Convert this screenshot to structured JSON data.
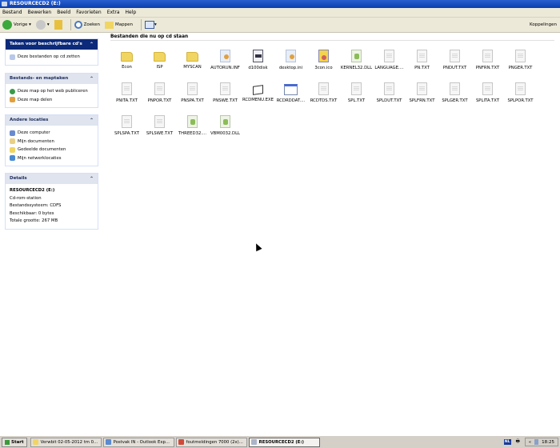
{
  "window": {
    "title": "RESOURCECD2 (E:)"
  },
  "menu": [
    "Bestand",
    "Bewerken",
    "Beeld",
    "Favorieten",
    "Extra",
    "Help"
  ],
  "toolbar": {
    "back": "Vorige",
    "search": "Zoeken",
    "folders": "Mappen",
    "links": "Koppelingen"
  },
  "sidebar": {
    "cd_tasks": {
      "title": "Taken voor beschrijfbare cd's",
      "items": [
        "Deze bestanden op cd zetten"
      ]
    },
    "file_tasks": {
      "title": "Bestands- en maptaken",
      "items": [
        "Deze map op het web publiceren",
        "Deze map delen"
      ]
    },
    "other_places": {
      "title": "Andere locaties",
      "items": [
        "Deze computer",
        "Mijn documenten",
        "Gedeelde documenten",
        "Mijn netwerklocaties"
      ]
    },
    "details": {
      "title": "Details",
      "name": "RESOURCECD2 (E:)",
      "type": "Cd-rom-station",
      "filesystem": "Bestandssysteem: CDFS",
      "free": "Beschikbaar: 0 bytes",
      "total": "Totale grootte: 267 MB"
    }
  },
  "content": {
    "header": "Bestanden die nu op cd staan",
    "files": [
      {
        "name": "Econ",
        "type": "folder"
      },
      {
        "name": "ISP",
        "type": "folder"
      },
      {
        "name": "MYSCAN",
        "type": "folder"
      },
      {
        "name": "AUTORUN.INF",
        "type": "ini"
      },
      {
        "name": "d100disk",
        "type": "sys"
      },
      {
        "name": "desktop.ini",
        "type": "ini"
      },
      {
        "name": "3con.ico",
        "type": "ico"
      },
      {
        "name": "KERNEL32.DLL",
        "type": "dll"
      },
      {
        "name": "LANGUAGE....",
        "type": "txt"
      },
      {
        "name": "PN.TXT",
        "type": "txt"
      },
      {
        "name": "PNDUT.TXT",
        "type": "txt"
      },
      {
        "name": "PNFRN.TXT",
        "type": "txt"
      },
      {
        "name": "PNGER.TXT",
        "type": "txt"
      },
      {
        "name": "PNITA.TXT",
        "type": "txt"
      },
      {
        "name": "PNPOR.TXT",
        "type": "txt"
      },
      {
        "name": "PNSPA.TXT",
        "type": "txt"
      },
      {
        "name": "PNSWE.TXT",
        "type": "txt"
      },
      {
        "name": "RCDMENU.EXE",
        "type": "exe"
      },
      {
        "name": "RCDRDDAT....",
        "type": "win"
      },
      {
        "name": "RCDTDS.TXT",
        "type": "txt"
      },
      {
        "name": "SPL.TXT",
        "type": "txt"
      },
      {
        "name": "SPLDUT.TXT",
        "type": "txt"
      },
      {
        "name": "SPLFRN.TXT",
        "type": "txt"
      },
      {
        "name": "SPLGER.TXT",
        "type": "txt"
      },
      {
        "name": "SPLITA.TXT",
        "type": "txt"
      },
      {
        "name": "SPLPOR.TXT",
        "type": "txt"
      },
      {
        "name": "SPLSPA.TXT",
        "type": "txt"
      },
      {
        "name": "SPLSWE.TXT",
        "type": "txt"
      },
      {
        "name": "THREED32....",
        "type": "dll"
      },
      {
        "name": "VBM0032.DLL",
        "type": "dll"
      }
    ]
  },
  "taskbar": {
    "start": "Start",
    "tasks": [
      {
        "label": "Verwbit 02-05-2012 tm 0...",
        "color": "#f1d563"
      },
      {
        "label": "Postvak IN - Outlook Exp...",
        "color": "#5a8ad0"
      },
      {
        "label": "foutmeldingen 7000 (2x)...",
        "color": "#d04a3a"
      },
      {
        "label": "RESOURCECD2 (E:)",
        "color": "#aab4c8",
        "active": true
      }
    ],
    "lang": "NL",
    "clock": "18:25"
  }
}
